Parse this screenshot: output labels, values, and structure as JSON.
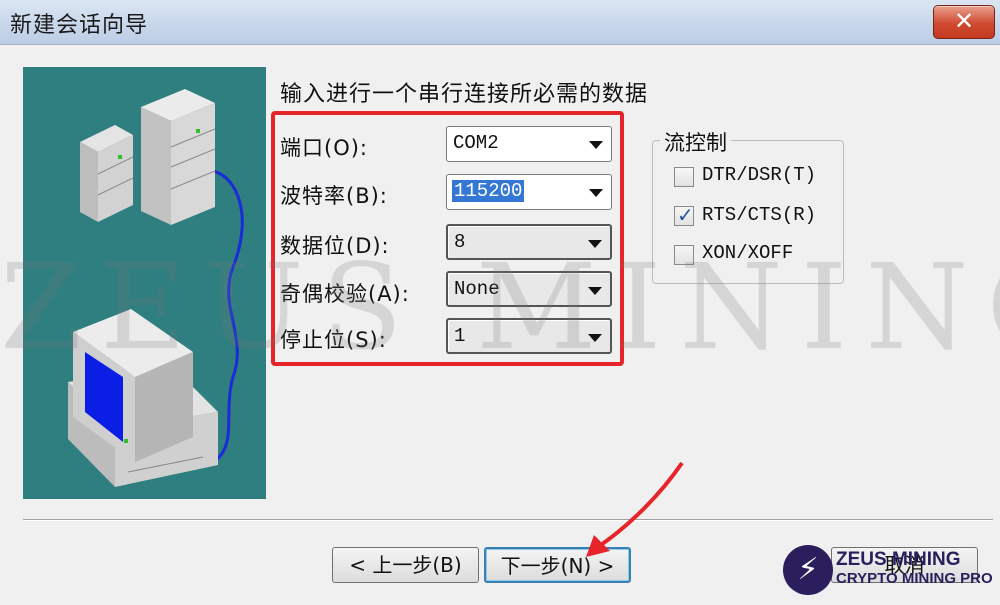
{
  "window": {
    "title": "新建会话向导"
  },
  "prompt": "输入进行一个串行连接所必需的数据",
  "fields": [
    {
      "label": "端口(O):",
      "value": "COM2"
    },
    {
      "label": "波特率(B):",
      "value": "115200"
    },
    {
      "label": "数据位(D):",
      "value": "8"
    },
    {
      "label": "奇偶校验(A):",
      "value": "None"
    },
    {
      "label": "停止位(S):",
      "value": "1"
    }
  ],
  "flow_control": {
    "title": "流控制",
    "options": [
      {
        "label": "DTR/DSR(T)",
        "checked": false
      },
      {
        "label": "RTS/CTS(R)",
        "checked": true
      },
      {
        "label": "XON/XOFF",
        "checked": false
      }
    ]
  },
  "buttons": {
    "back": "< 上一步(B)",
    "next": "下一步(N) >",
    "cancel": "取消"
  },
  "watermark": {
    "text": "ZEUS MINING",
    "brand_line1": "ZEUS MINING",
    "brand_line2": "CRYPTO MINING PRO"
  },
  "colors": {
    "highlight": "#e5252a",
    "illustration_bg": "#2f7f80",
    "selection": "#3577d4"
  }
}
